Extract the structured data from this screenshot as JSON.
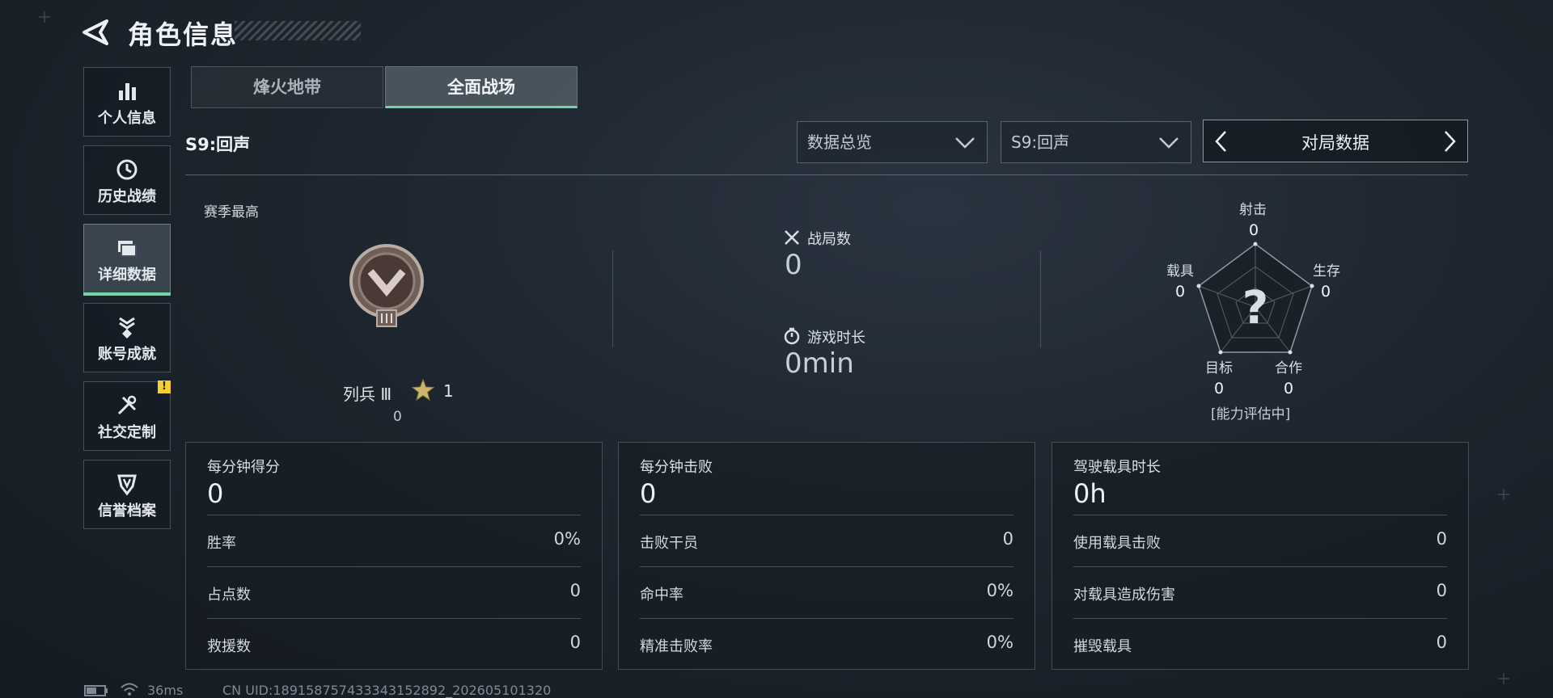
{
  "header": {
    "title": "角色信息"
  },
  "sidebar": {
    "items": [
      {
        "label": "个人信息",
        "icon": "bar-chart-icon"
      },
      {
        "label": "历史战绩",
        "icon": "history-clock-icon"
      },
      {
        "label": "详细数据",
        "icon": "folder-icon",
        "active": true
      },
      {
        "label": "账号成就",
        "icon": "achievement-icon"
      },
      {
        "label": "社交定制",
        "icon": "tools-icon",
        "badge": "!"
      },
      {
        "label": "信誉档案",
        "icon": "shield-icon"
      }
    ]
  },
  "tabs": [
    {
      "label": "烽火地带",
      "active": false
    },
    {
      "label": "全面战场",
      "active": true
    }
  ],
  "season_title": "S9:回声",
  "filters": {
    "dropdown1": "数据总览",
    "dropdown2": "S9:回声",
    "navigator": "对局数据"
  },
  "season_best": {
    "label": "赛季最高",
    "rank_name": "列兵 Ⅲ",
    "stars": "1",
    "points": "0"
  },
  "summary": {
    "matches_label": "战局数",
    "matches_value": "0",
    "playtime_label": "游戏时长",
    "playtime_value": "0min"
  },
  "radar": {
    "shooting": {
      "label": "射击",
      "value": "0"
    },
    "survival": {
      "label": "生存",
      "value": "0"
    },
    "cooperation": {
      "label": "合作",
      "value": "0"
    },
    "objective": {
      "label": "目标",
      "value": "0"
    },
    "vehicle": {
      "label": "载具",
      "value": "0"
    },
    "center_symbol": "?",
    "caption": "[能力评估中]"
  },
  "cards": [
    {
      "title": "每分钟得分",
      "big": "0",
      "rows": [
        {
          "label": "胜率",
          "value": "0%"
        },
        {
          "label": "占点数",
          "value": "0"
        },
        {
          "label": "救援数",
          "value": "0"
        }
      ]
    },
    {
      "title": "每分钟击败",
      "big": "0",
      "rows": [
        {
          "label": "击败干员",
          "value": "0"
        },
        {
          "label": "命中率",
          "value": "0%"
        },
        {
          "label": "精准击败率",
          "value": "0%"
        }
      ]
    },
    {
      "title": "驾驶载具时长",
      "big": "0h",
      "rows": [
        {
          "label": "使用载具击败",
          "value": "0"
        },
        {
          "label": "对载具造成伤害",
          "value": "0"
        },
        {
          "label": "摧毁载具",
          "value": "0"
        }
      ]
    }
  ],
  "footer": {
    "ping": "36ms",
    "uid": "CN UID:18915875743334315289​2_202605101320"
  },
  "colors": {
    "accent": "#6fd6a3",
    "badge": "#f3cf35",
    "background": "#1d252e"
  }
}
